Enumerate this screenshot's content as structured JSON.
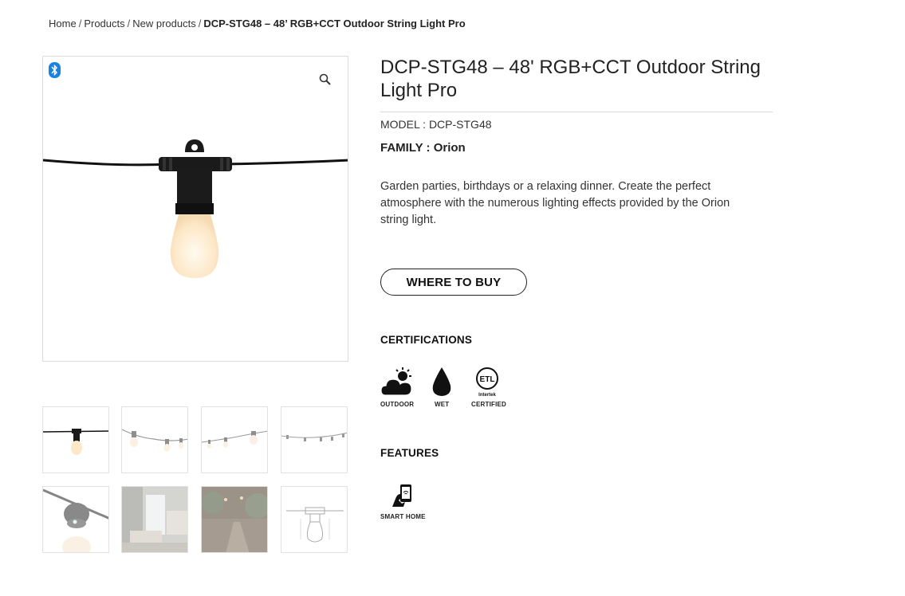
{
  "breadcrumb": {
    "items": [
      "Home",
      "Products",
      "New products"
    ],
    "separator": "/",
    "current": "DCP-STG48 – 48’ RGB+CCT Outdoor String Light Pro"
  },
  "product": {
    "title": "DCP-STG48 – 48' RGB+CCT Outdoor String Light Pro",
    "model_label": "MODEL : ",
    "model_value": "DCP-STG48",
    "family_label": "FAMILY : ",
    "family_value": "Orion",
    "description": "Garden parties, birthdays or a relaxing dinner. Create the perfect atmosphere with the numerous lighting effects provided by the Orion string light.",
    "buy_label": "WHERE TO BUY"
  },
  "gallery": {
    "badge_icon": "bluetooth-icon",
    "zoom_icon": "magnifier-icon",
    "thumb_count": 8,
    "active_thumb": 1
  },
  "certifications": {
    "heading": "CERTIFICATIONS",
    "items": [
      {
        "icon": "outdoor-cloud-sun-icon",
        "label": "OUTDOOR"
      },
      {
        "icon": "water-drop-icon",
        "label": "WET"
      },
      {
        "icon": "etl-intertek-icon",
        "label": "CERTIFIED",
        "logo_text": "ETL",
        "logo_sub": "Intertek"
      }
    ]
  },
  "features": {
    "heading": "FEATURES",
    "items": [
      {
        "icon": "smartphone-hand-icon",
        "label": "SMART HOME"
      }
    ]
  },
  "colors": {
    "text": "#222222",
    "border": "#dcdcdc",
    "bulb_glow": "#fde8c8",
    "bluetooth": "#1a82e2"
  }
}
